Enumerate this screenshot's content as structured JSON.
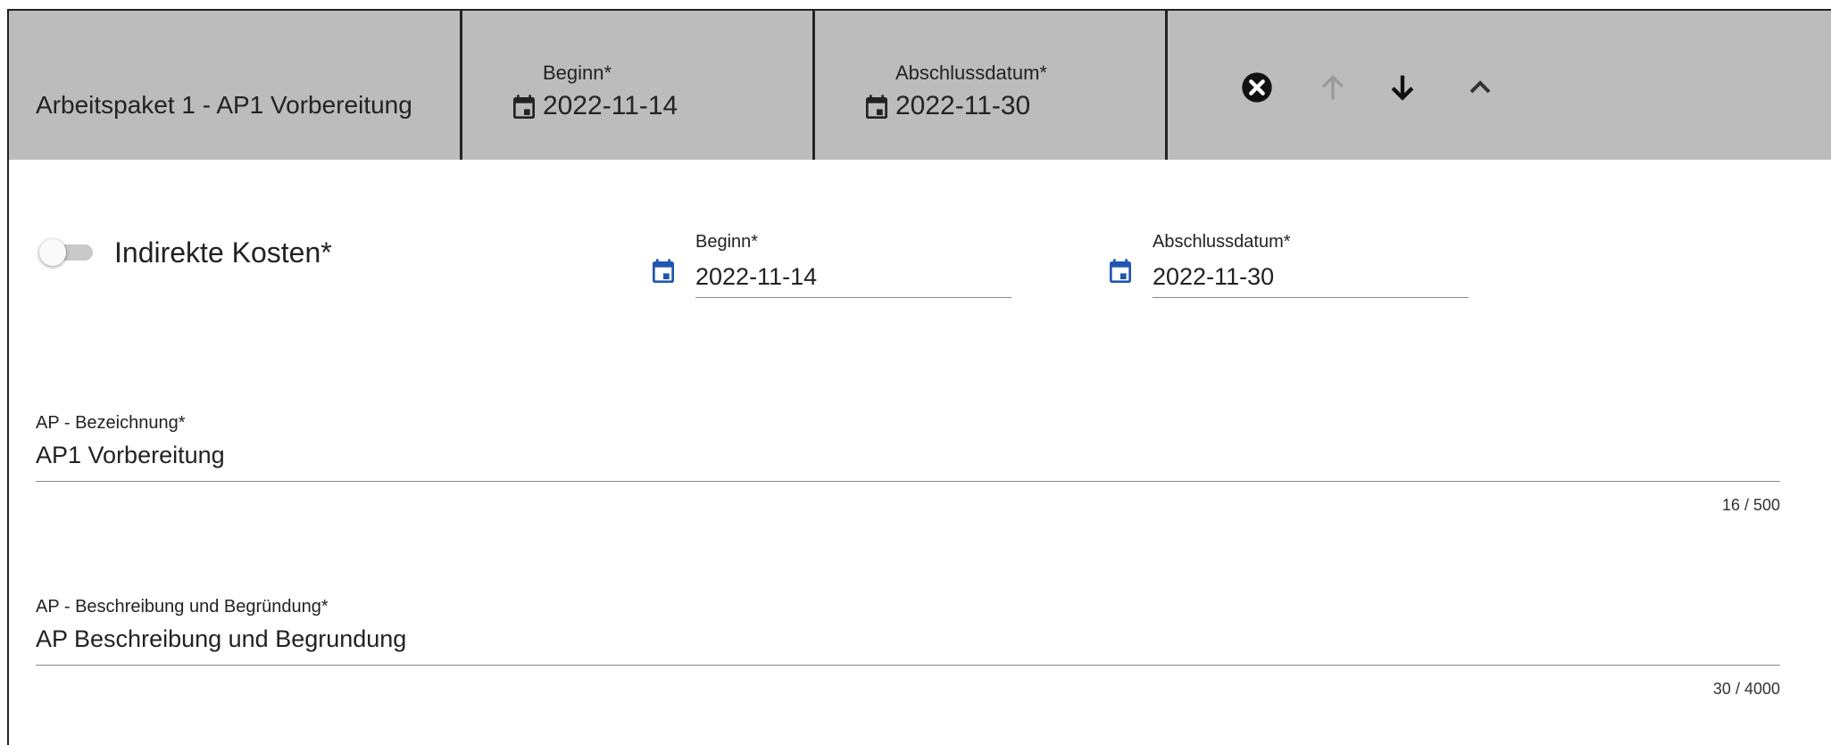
{
  "header": {
    "title": "Arbeitspaket 1 - AP1 Vorbereitung",
    "begin_label": "Beginn*",
    "begin_value": "2022-11-14",
    "end_label": "Abschlussdatum*",
    "end_value": "2022-11-30",
    "controls": {
      "remove_icon": "close-circle-icon",
      "up_icon": "arrow-up-icon",
      "down_icon": "arrow-down-icon",
      "collapse_icon": "chevron-up-icon"
    }
  },
  "body": {
    "indirect_costs_label": "Indirekte Kosten*",
    "indirect_costs_enabled": false,
    "begin_label": "Beginn*",
    "begin_value": "2022-11-14",
    "end_label": "Abschlussdatum*",
    "end_value": "2022-11-30",
    "name_field": {
      "label": "AP - Bezeichnung*",
      "value": "AP1 Vorbereitung",
      "counter": "16 / 500"
    },
    "description_field": {
      "label": "AP - Beschreibung und Begründung*",
      "value": "AP Beschreibung und Begrundung",
      "counter": "30 / 4000"
    }
  },
  "colors": {
    "header_bg": "#bcbcbc",
    "accent_blue": "#1e56b0",
    "icon_dark": "#222222",
    "icon_disabled": "#9a9a9a"
  }
}
